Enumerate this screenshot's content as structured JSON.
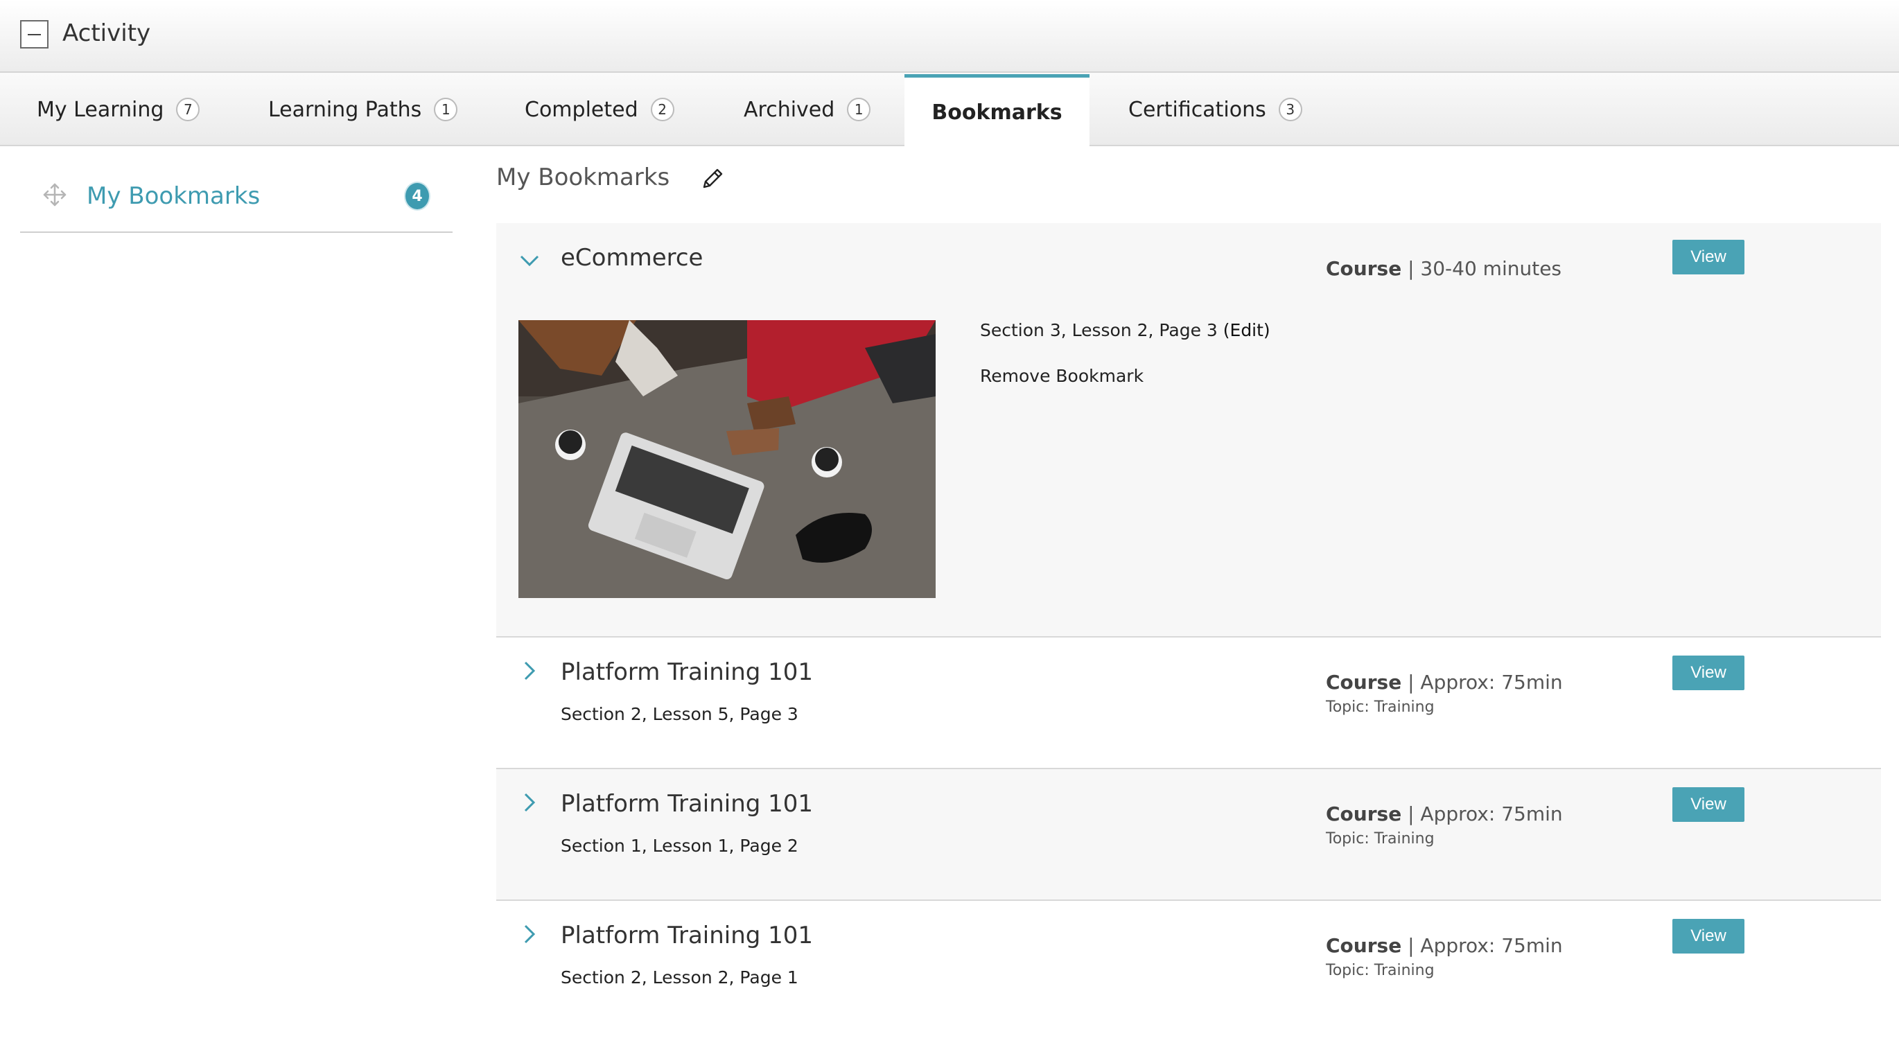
{
  "header": {
    "title": "Activity"
  },
  "tabs": [
    {
      "label": "My Learning",
      "count": "7"
    },
    {
      "label": "Learning Paths",
      "count": "1"
    },
    {
      "label": "Completed",
      "count": "2"
    },
    {
      "label": "Archived",
      "count": "1"
    },
    {
      "label": "Bookmarks",
      "count": ""
    },
    {
      "label": "Certifications",
      "count": "3"
    }
  ],
  "active_tab": "Bookmarks",
  "sidebar": {
    "label": "My Bookmarks",
    "count": "4"
  },
  "main": {
    "title": "My Bookmarks"
  },
  "bookmarks": [
    {
      "title": "eCommerce",
      "type": "Course",
      "duration": "30-40 minutes",
      "expanded": true,
      "location": "Section 3, Lesson 2, Page 3",
      "edit_label": "(Edit)",
      "remove_label": "Remove Bookmark",
      "view_label": "View"
    },
    {
      "title": "Platform Training 101",
      "type": "Course",
      "duration": "Approx: 75min",
      "topic": "Topic: Training",
      "location": "Section 2, Lesson 5, Page 3",
      "view_label": "View"
    },
    {
      "title": "Platform Training 101",
      "type": "Course",
      "duration": "Approx: 75min",
      "topic": "Topic: Training",
      "location": "Section 1, Lesson 1, Page 2",
      "view_label": "View"
    },
    {
      "title": "Platform Training 101",
      "type": "Course",
      "duration": "Approx: 75min",
      "topic": "Topic: Training",
      "location": "Section 2, Lesson 2, Page 1",
      "view_label": "View"
    }
  ],
  "colors": {
    "accent": "#4aa3b5",
    "link": "#3e9bb0"
  }
}
